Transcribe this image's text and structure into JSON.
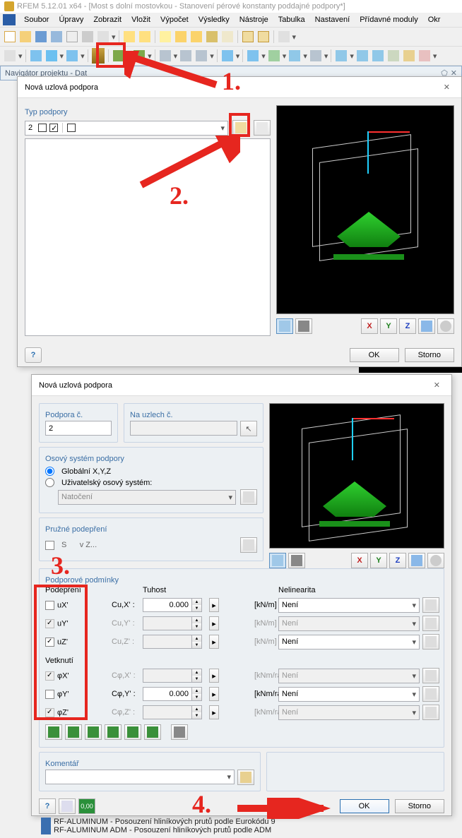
{
  "titlebar": "RFEM 5.12.01 x64 - [Most s dolní mostovkou - Stanovení pérové konstanty poddajné podpory*]",
  "menus": [
    "Soubor",
    "Úpravy",
    "Zobrazit",
    "Vložit",
    "Výpočet",
    "Výsledky",
    "Nástroje",
    "Tabulka",
    "Nastavení",
    "Přídavné moduly",
    "Okr"
  ],
  "navigator": {
    "title": "Navigátor projektu - Dat"
  },
  "dialog1": {
    "title": "Nová uzlová podpora",
    "type_group": "Typ podpory",
    "type_value": "2",
    "ok": "OK",
    "cancel": "Storno"
  },
  "dialog2": {
    "title": "Nová uzlová podpora",
    "support_no_label": "Podpora č.",
    "support_no": "2",
    "on_nodes_label": "Na uzlech č.",
    "on_nodes": "",
    "axis_group": "Osový systém podpory",
    "axis_global": "Globální X,Y,Z",
    "axis_user": "Uživatelský osový systém:",
    "axis_user_value": "Natočení",
    "spring_group": "Pružné podepření",
    "spring_item": "v Z...",
    "conditions_group": "Podporové podmínky",
    "col_support": "Podepření",
    "col_stiffness": "Tuhost",
    "col_nonlin": "Nelinearita",
    "rows_support": {
      "uX": {
        "label": "uX'",
        "checked": false,
        "enabled": true
      },
      "uY": {
        "label": "uY'",
        "checked": true,
        "enabled": false
      },
      "uZ": {
        "label": "uZ'",
        "checked": true,
        "enabled": true
      }
    },
    "rows_fix_header": "Vetknutí",
    "rows_fix": {
      "phiX": {
        "label": "φX'",
        "checked": true,
        "enabled": false
      },
      "phiY": {
        "label": "φY'",
        "checked": false,
        "enabled": true
      },
      "phiZ": {
        "label": "φZ'",
        "checked": true,
        "enabled": false
      }
    },
    "stiffness": {
      "CuX": {
        "label": "Cu,X' :",
        "value": "0.000",
        "unit": "[kN/m]",
        "enabled": true
      },
      "CuY": {
        "label": "Cu,Y' :",
        "value": "",
        "unit": "[kN/m]",
        "enabled": false
      },
      "CuZ": {
        "label": "Cu,Z' :",
        "value": "",
        "unit": "[kN/m]",
        "enabled": false
      },
      "CphiX": {
        "label": "Cφ,X' :",
        "value": "",
        "unit": "[kNm/rad]",
        "enabled": false
      },
      "CphiY": {
        "label": "Cφ,Y' :",
        "value": "0.000",
        "unit": "[kNm/rad]",
        "enabled": true
      },
      "CphiZ": {
        "label": "Cφ,Z' :",
        "value": "",
        "unit": "[kNm/rad]",
        "enabled": false
      }
    },
    "nonlin": {
      "uX": {
        "value": "Není",
        "enabled": true
      },
      "uY": {
        "value": "Není",
        "enabled": false
      },
      "uZ": {
        "value": "Není",
        "enabled": true
      },
      "phiX": {
        "value": "Není",
        "enabled": false
      },
      "phiY": {
        "value": "Není",
        "enabled": true
      },
      "phiZ": {
        "value": "Není",
        "enabled": false
      }
    },
    "comment_label": "Komentář",
    "comment": "",
    "ok": "OK",
    "cancel": "Storno"
  },
  "tree_rows": [
    "RF-ALUMINUM - Posouzení hliníkových prutů podle Eurokódu 9",
    "RF-ALUMINUM ADM - Posouzení hliníkových prutů podle ADM"
  ],
  "annotations": {
    "n1": "1.",
    "n2": "2.",
    "n3": "3.",
    "n4": "4."
  }
}
